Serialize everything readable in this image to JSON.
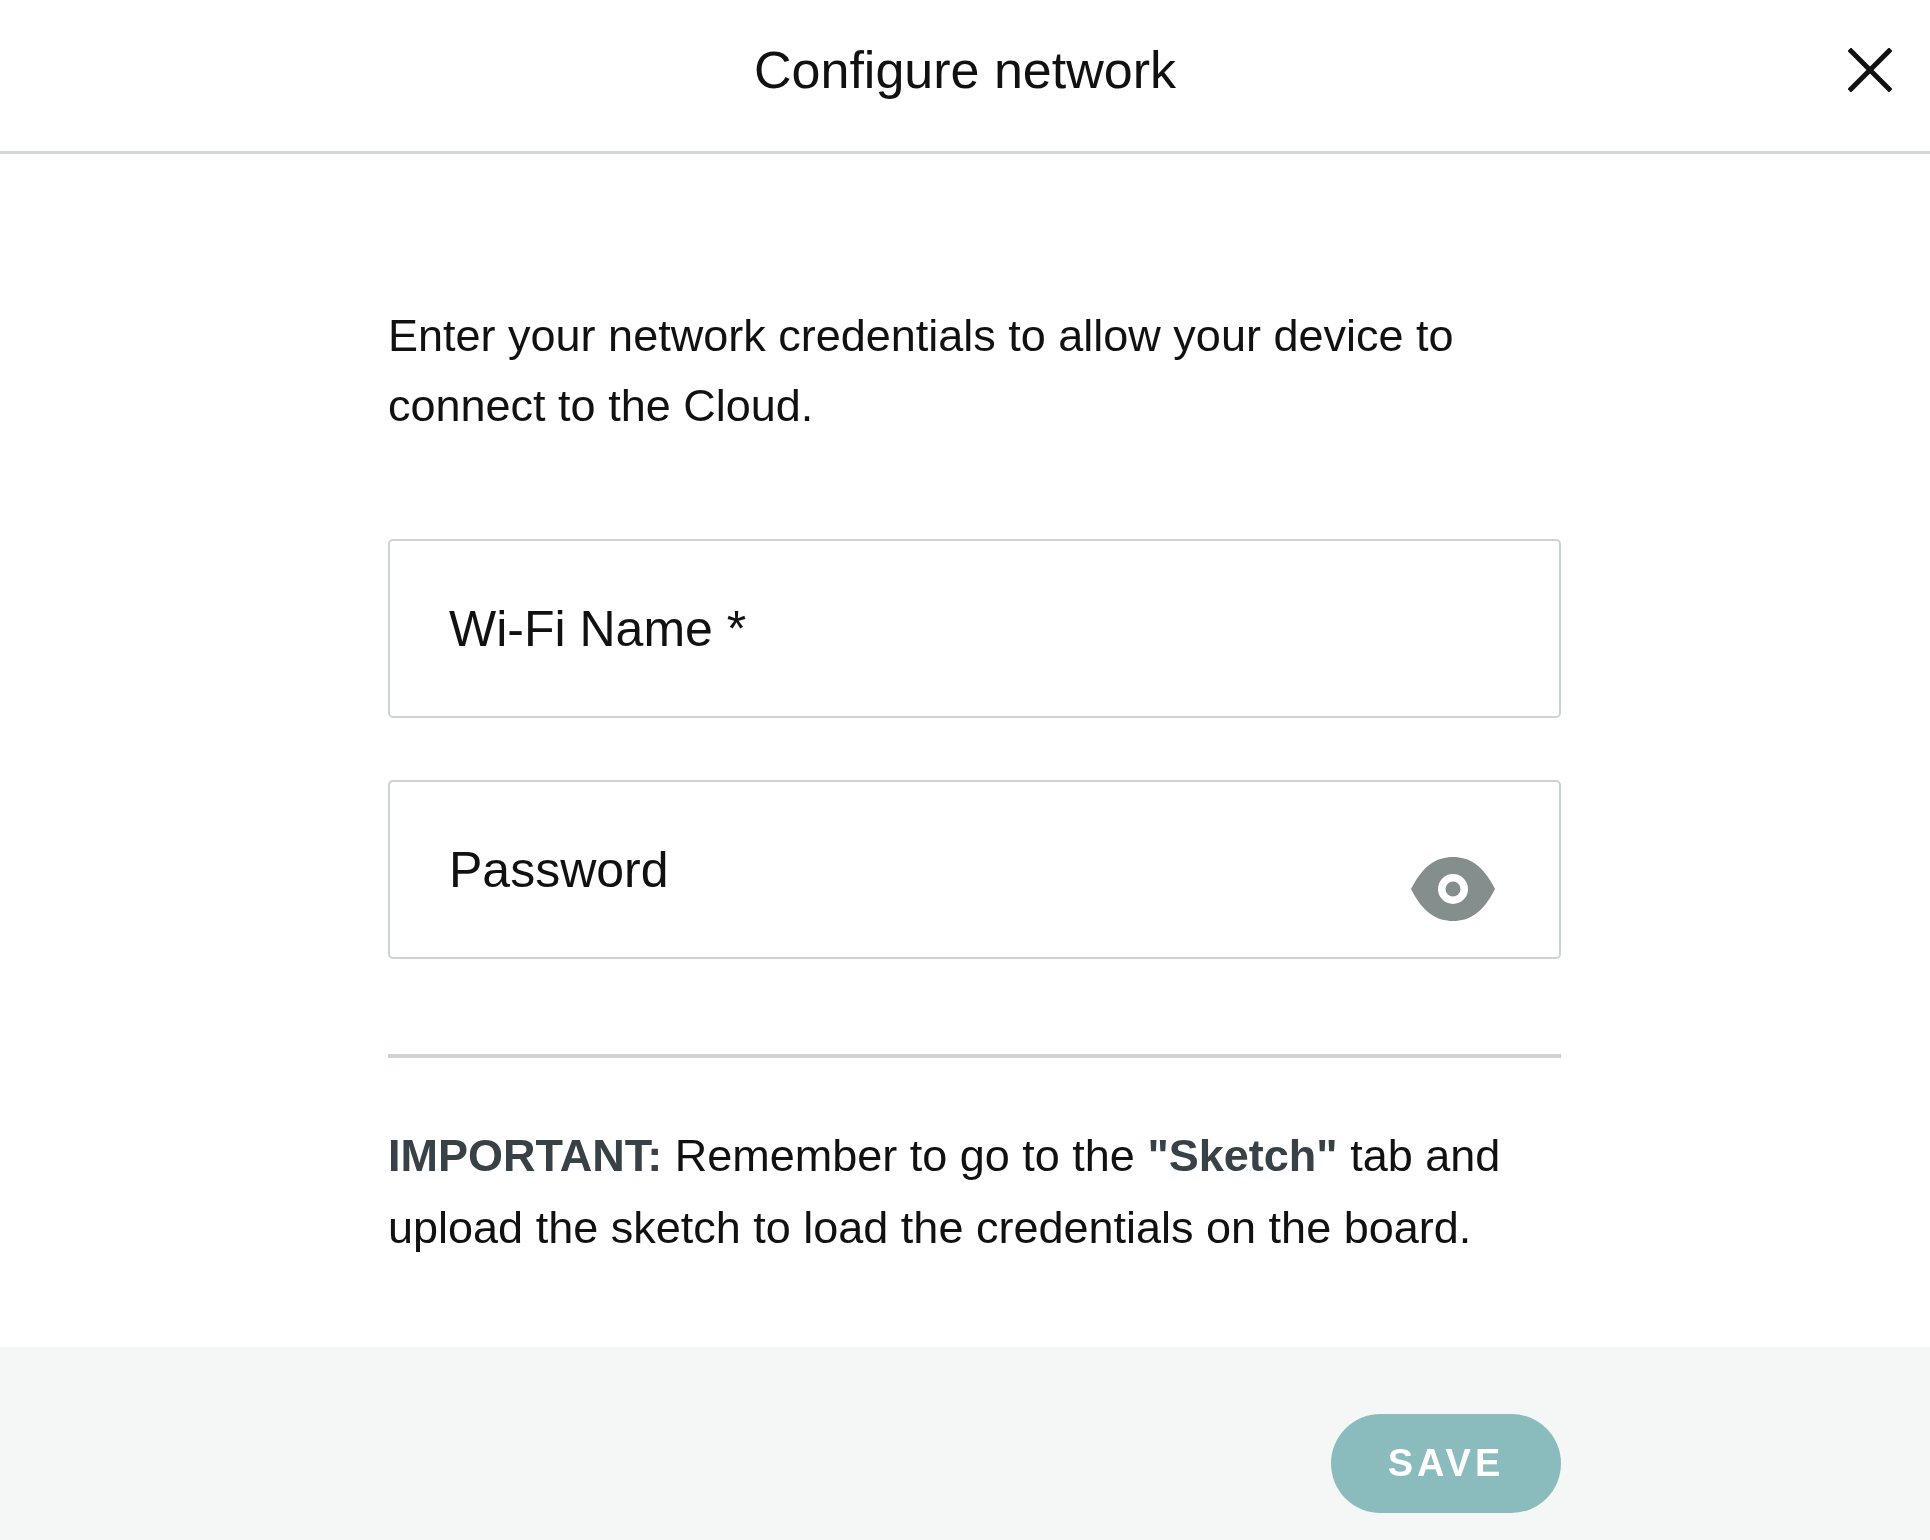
{
  "dialog": {
    "title": "Configure network"
  },
  "intro": "Enter your network credentials to allow your device to connect to the Cloud.",
  "fields": [
    {
      "kind": "text",
      "placeholder": "Wi-Fi Name *"
    },
    {
      "kind": "password",
      "placeholder": "Password"
    }
  ],
  "note": "**IMPORTANT:** Remember to go to the **\"Sketch\"** tab and upload the sketch to load the credentials on the board.",
  "save_button": {
    "label": "SAVE",
    "disabled": true
  }
}
